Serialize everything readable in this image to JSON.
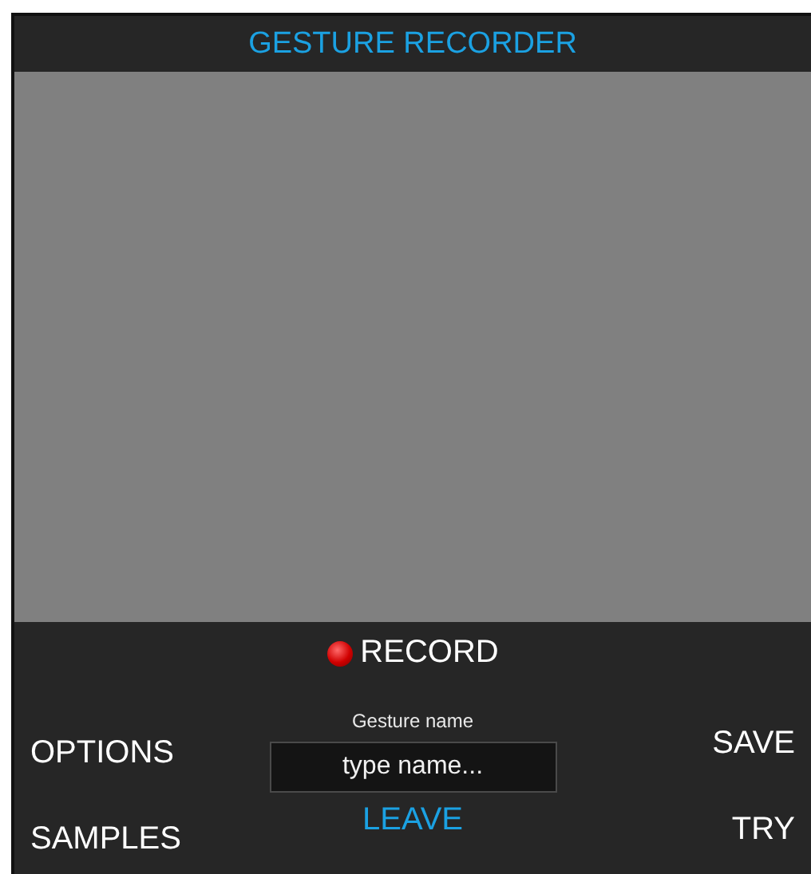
{
  "window": {
    "title": "GESTURE RECORDER"
  },
  "canvas": {
    "kind": "blank"
  },
  "record_button": {
    "label": "RECORD",
    "recording": true
  },
  "left_buttons": [
    "OPTIONS",
    "SAMPLES"
  ],
  "gesture_name": {
    "label": "Gesture name",
    "placeholder": "type name..."
  },
  "leave_button": {
    "label": "LEAVE"
  },
  "right_buttons": [
    "SAVE",
    "TRY"
  ]
}
